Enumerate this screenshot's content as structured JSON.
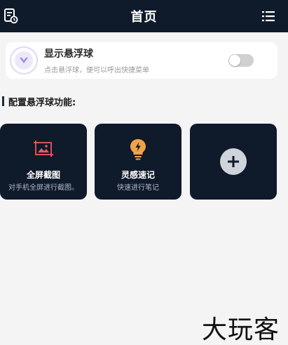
{
  "header": {
    "title": "首页",
    "left_icon": "document-icon",
    "right_icon": "menu-list-icon"
  },
  "float_ball": {
    "title": "显示悬浮球",
    "subtitle": "点击悬浮球，便可以呼出快捷菜单",
    "logo_icon": "chevron-down-logo-icon",
    "toggle_on": false
  },
  "section": {
    "title": "配置悬浮球功能:"
  },
  "tiles": [
    {
      "title": "全屏截图",
      "desc": "对手机全屏进行截图。",
      "icon": "screenshot-image-icon",
      "icon_color": "#e85a63"
    },
    {
      "title": "灵感速记",
      "desc": "快速进行笔记",
      "icon": "lightbulb-icon",
      "icon_color": "#f0a24a"
    },
    {
      "icon": "plus-circle-icon"
    }
  ],
  "watermark": {
    "text": "大玩客"
  },
  "colors": {
    "header_bg": "#0f1a2a",
    "page_bg": "#f4f4f5",
    "tile_bg": "#0f1a2a",
    "logo_purple": "#a089e0"
  }
}
